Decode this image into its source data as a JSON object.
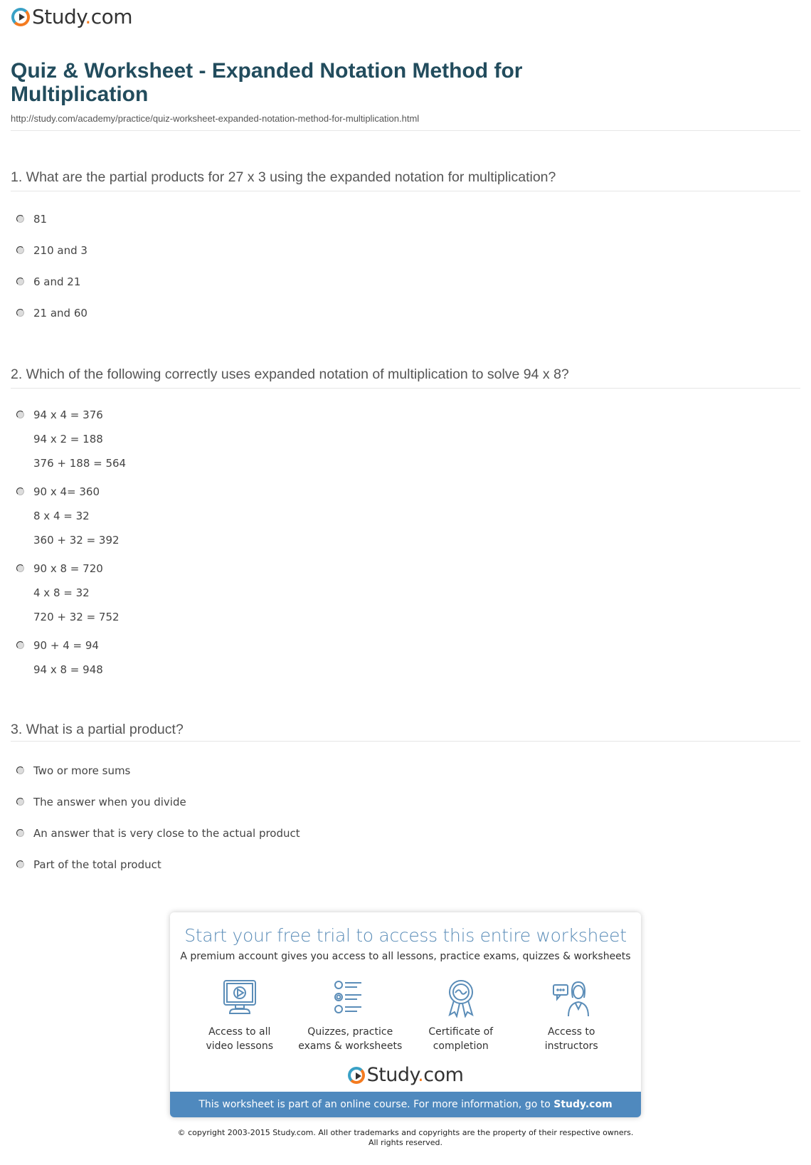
{
  "brand": {
    "name_main": "Study",
    "name_dot": ".",
    "name_tld": "com",
    "accent_orange": "#f47b20",
    "accent_blue": "#3aa1c6"
  },
  "page": {
    "title": "Quiz & Worksheet - Expanded Notation Method for Multiplication",
    "url": "http://study.com/academy/practice/quiz-worksheet-expanded-notation-method-for-multiplication.html"
  },
  "questions": [
    {
      "text": "1. What are the partial products for 27 x 3 using the expanded notation for multiplication?",
      "answers": [
        [
          "81"
        ],
        [
          "210 and 3"
        ],
        [
          "6 and 21"
        ],
        [
          "21 and 60"
        ]
      ]
    },
    {
      "text": "2. Which of the following correctly uses expanded notation of multiplication to solve 94 x 8?",
      "answers": [
        [
          "94 x 4 = 376",
          "94 x 2 = 188",
          "376 + 188 = 564"
        ],
        [
          "90 x 4= 360",
          "8 x 4 = 32",
          "360 + 32 = 392"
        ],
        [
          "90 x 8 = 720",
          "4 x 8 = 32",
          "720 + 32 = 752"
        ],
        [
          "90 + 4 = 94",
          "94 x 8 = 948"
        ]
      ]
    },
    {
      "text": "3. What is a partial product?",
      "answers": [
        [
          "Two or more sums"
        ],
        [
          "The answer when you divide"
        ],
        [
          "An answer that is very close to the actual product"
        ],
        [
          "Part of the total product"
        ]
      ]
    }
  ],
  "promo": {
    "headline": "Start your free trial to access this entire worksheet",
    "subheadline": "A premium account gives you access to all lessons, practice exams, quizzes & worksheets",
    "features": [
      {
        "icon": "video-monitor-icon",
        "line1": "Access to all",
        "line2": "video lessons"
      },
      {
        "icon": "quiz-list-icon",
        "line1": "Quizzes, practice",
        "line2": "exams & worksheets"
      },
      {
        "icon": "certificate-ribbon-icon",
        "line1": "Certificate of",
        "line2": "completion"
      },
      {
        "icon": "instructor-chat-icon",
        "line1": "Access to",
        "line2": "instructors"
      }
    ],
    "bar_text": "This worksheet is part of an online course. For more information, go to ",
    "bar_link": "Study.com",
    "bar_color": "#4f89be",
    "headline_color": "#5b8db8"
  },
  "footer": {
    "copyright_line1": "© copyright 2003-2015 Study.com. All other trademarks and copyrights are the property of their respective owners.",
    "copyright_line2": "All rights reserved."
  }
}
